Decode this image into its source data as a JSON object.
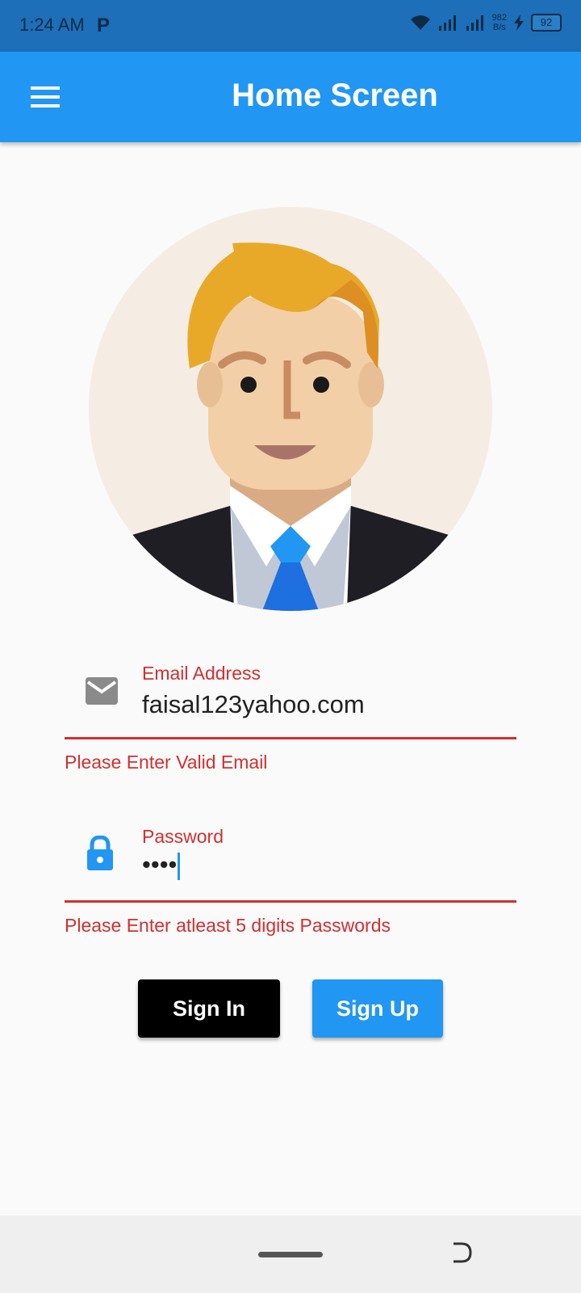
{
  "status_bar": {
    "time": "1:24 AM",
    "carrier_icon": "P",
    "net_speed_value": "982",
    "net_speed_unit": "B/s",
    "battery": "92"
  },
  "app_bar": {
    "title": "Home Screen",
    "menu_icon": "hamburger-menu-icon"
  },
  "avatar": {
    "icon": "businessman-avatar"
  },
  "email": {
    "label": "Email Address",
    "value": "faisal123yahoo.com",
    "error": "Please Enter Valid Email",
    "icon": "mail-icon"
  },
  "password": {
    "label": "Password",
    "value": "••••",
    "error": "Please Enter atleast 5 digits Passwords",
    "icon": "lock-icon"
  },
  "buttons": {
    "sign_in": "Sign In",
    "sign_up": "Sign Up"
  },
  "colors": {
    "primary": "#2196f3",
    "status_bar": "#1c6fb8",
    "error": "#d32f2f",
    "sign_in_bg": "#000000"
  }
}
